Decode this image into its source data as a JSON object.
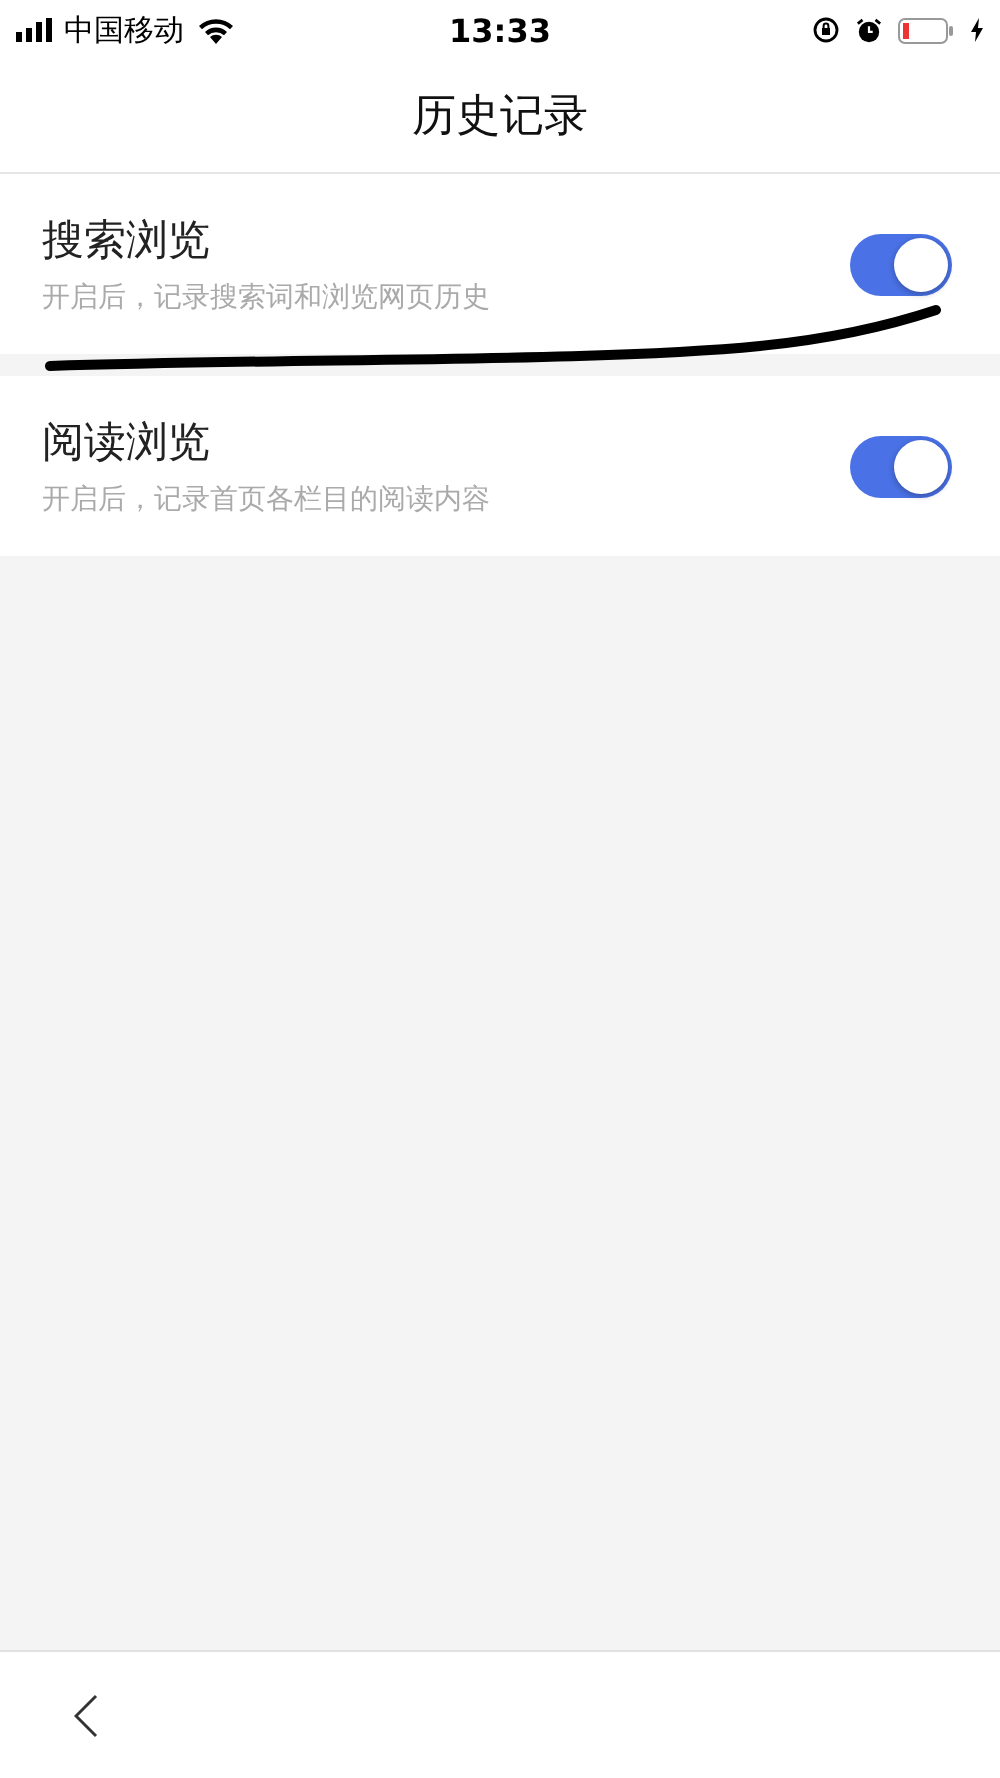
{
  "status_bar": {
    "carrier": "中国移动",
    "time": "13:33"
  },
  "title": "历史记录",
  "settings": [
    {
      "label": "搜索浏览",
      "description": "开启后，记录搜索词和浏览网页历史",
      "on": true
    },
    {
      "label": "阅读浏览",
      "description": "开启后，记录首页各栏目的阅读内容",
      "on": true
    }
  ]
}
